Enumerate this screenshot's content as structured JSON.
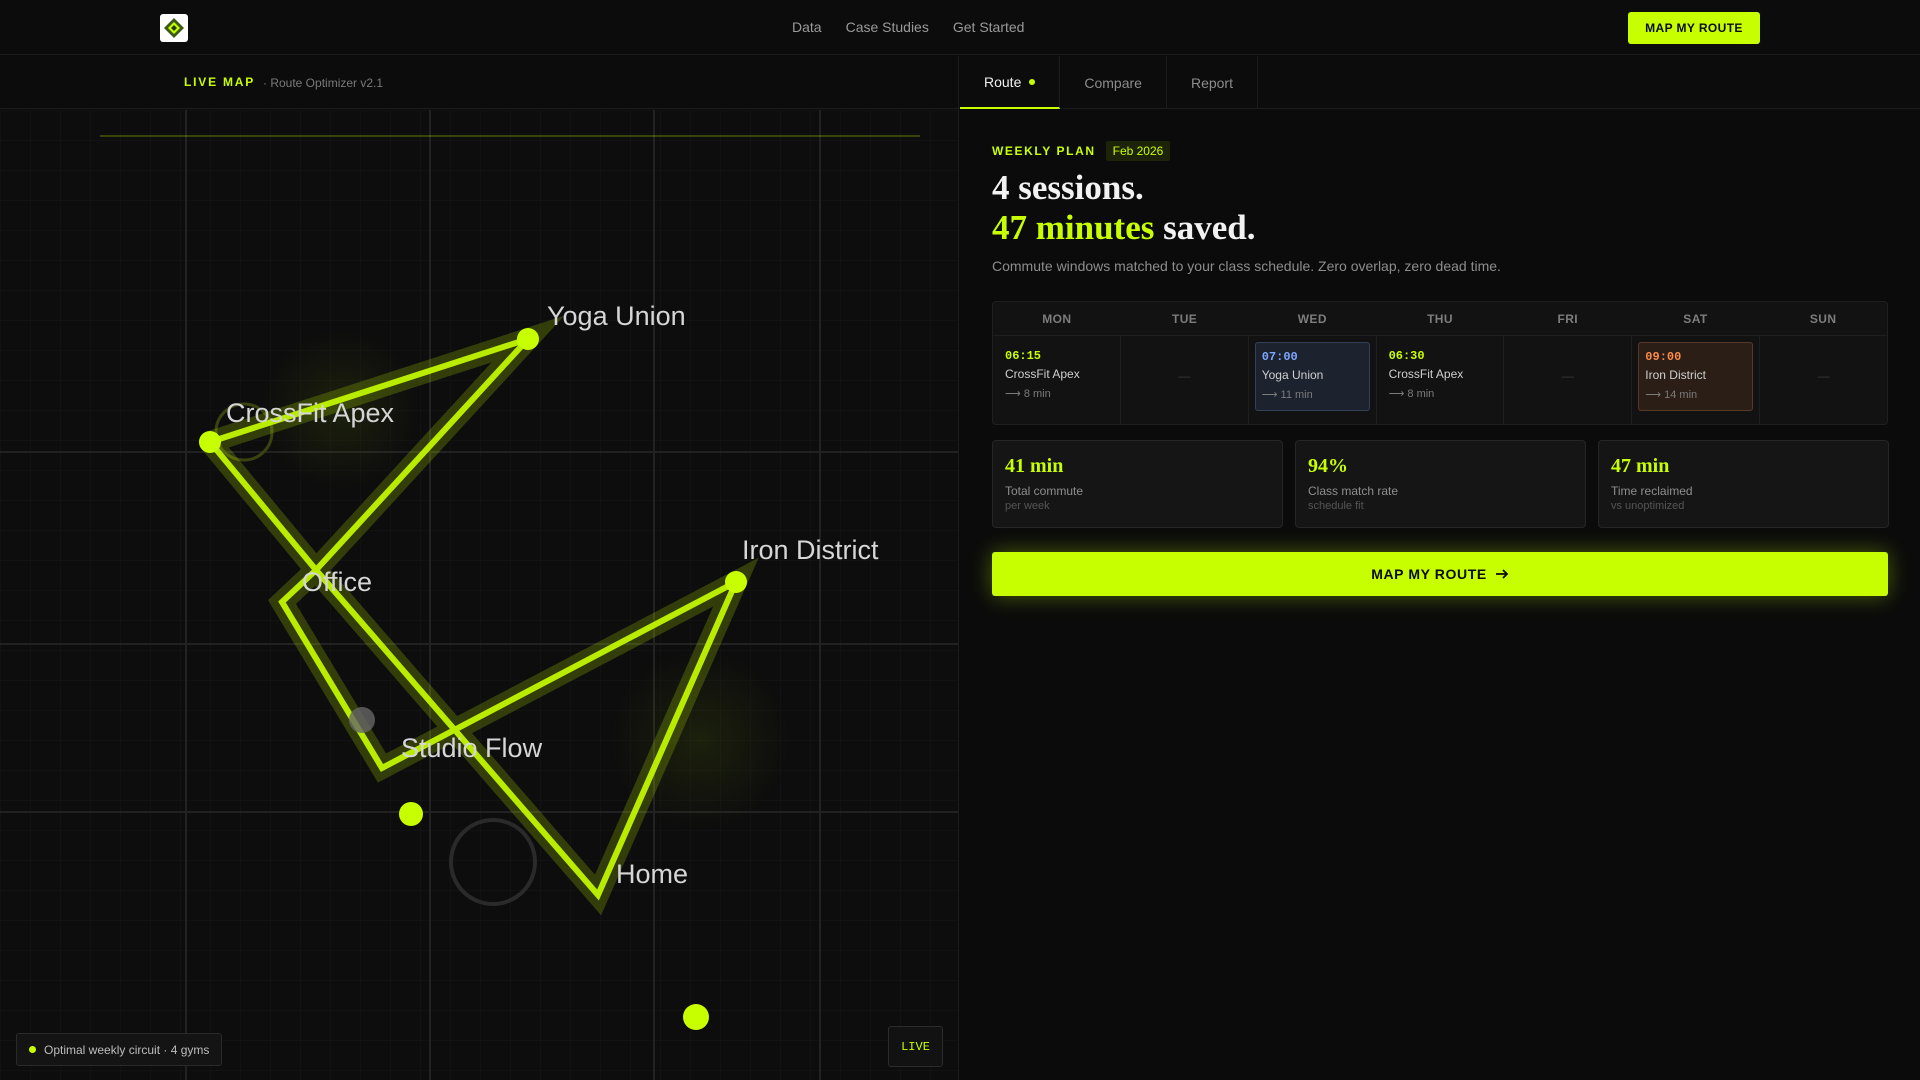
{
  "header": {
    "nav": [
      "Data",
      "Case Studies",
      "Get Started"
    ],
    "cta_label": "MAP MY ROUTE"
  },
  "map_panel": {
    "title": "LIVE MAP",
    "version": "· Route Optimizer v2.1",
    "locations": [
      "Yoga Union",
      "CrossFit Apex",
      "Office",
      "Iron District",
      "Studio Flow",
      "Home"
    ],
    "status_text": "Optimal weekly circuit · 4 gyms",
    "live_label": "LIVE",
    "accent_color": "#c8ff00"
  },
  "tabs": [
    {
      "label": "Route",
      "active": true
    },
    {
      "label": "Compare",
      "active": false
    },
    {
      "label": "Report",
      "active": false
    }
  ],
  "plan": {
    "eyebrow": "WEEKLY PLAN",
    "date": "Feb 2026",
    "headline_1": "4 sessions.",
    "headline_2_accent": "47 minutes",
    "headline_2_rest": " saved.",
    "subtitle": "Commute windows matched to your class schedule. Zero overlap, zero dead time."
  },
  "schedule": {
    "days": [
      "MON",
      "TUE",
      "WED",
      "THU",
      "FRI",
      "SAT",
      "SUN"
    ],
    "empty_mark": "—",
    "sessions": {
      "mon": {
        "time": "06:15",
        "gym": "CrossFit Apex",
        "commute": "⟶ 8 min"
      },
      "wed": {
        "time": "07:00",
        "gym": "Yoga Union",
        "commute": "⟶ 11 min"
      },
      "thu": {
        "time": "06:30",
        "gym": "CrossFit Apex",
        "commute": "⟶ 8 min"
      },
      "sat": {
        "time": "09:00",
        "gym": "Iron District",
        "commute": "⟶ 14 min"
      }
    }
  },
  "stats": [
    {
      "value": "41 min",
      "label": "Total commute",
      "sub": "per week"
    },
    {
      "value": "94%",
      "label": "Class match rate",
      "sub": "schedule fit"
    },
    {
      "value": "47 min",
      "label": "Time reclaimed",
      "sub": "vs unoptimized"
    }
  ],
  "main_cta": {
    "label": "MAP MY ROUTE",
    "icon": "arrow-right-icon"
  }
}
